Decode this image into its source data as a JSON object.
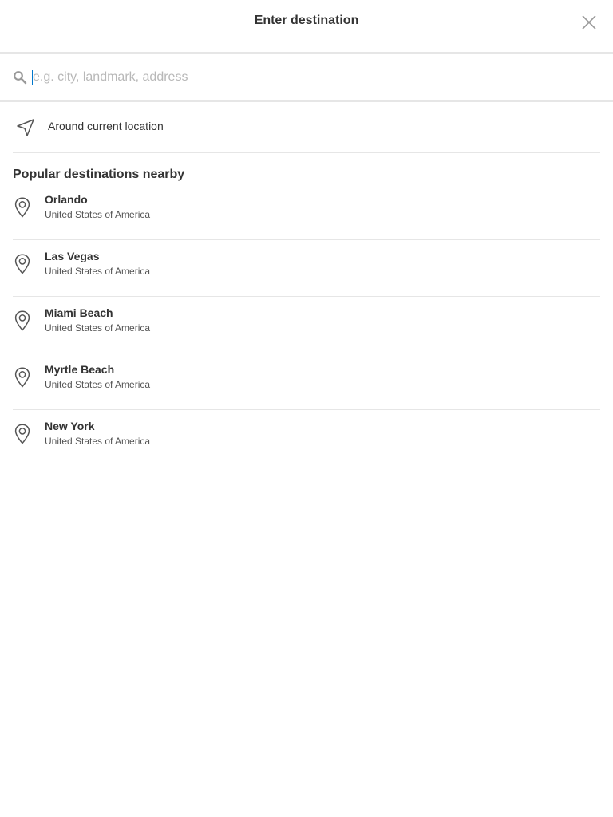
{
  "header": {
    "title": "Enter destination",
    "close_icon": "close-icon"
  },
  "search": {
    "icon": "search-icon",
    "value": "",
    "placeholder": "e.g. city, landmark, address"
  },
  "current_location": {
    "icon": "navigation-arrow-icon",
    "label": "Around current location"
  },
  "popular": {
    "title": "Popular destinations nearby",
    "items": [
      {
        "name": "Orlando",
        "country": "United States of America",
        "icon": "map-pin-icon"
      },
      {
        "name": "Las Vegas",
        "country": "United States of America",
        "icon": "map-pin-icon"
      },
      {
        "name": "Miami Beach",
        "country": "United States of America",
        "icon": "map-pin-icon"
      },
      {
        "name": "Myrtle Beach",
        "country": "United States of America",
        "icon": "map-pin-icon"
      },
      {
        "name": "New York",
        "country": "United States of America",
        "icon": "map-pin-icon"
      }
    ]
  },
  "colors": {
    "text": "#333333",
    "divider": "#e6e6e6",
    "placeholder": "#b8b8b8",
    "caret": "#0077cc",
    "icon": "#555555"
  }
}
